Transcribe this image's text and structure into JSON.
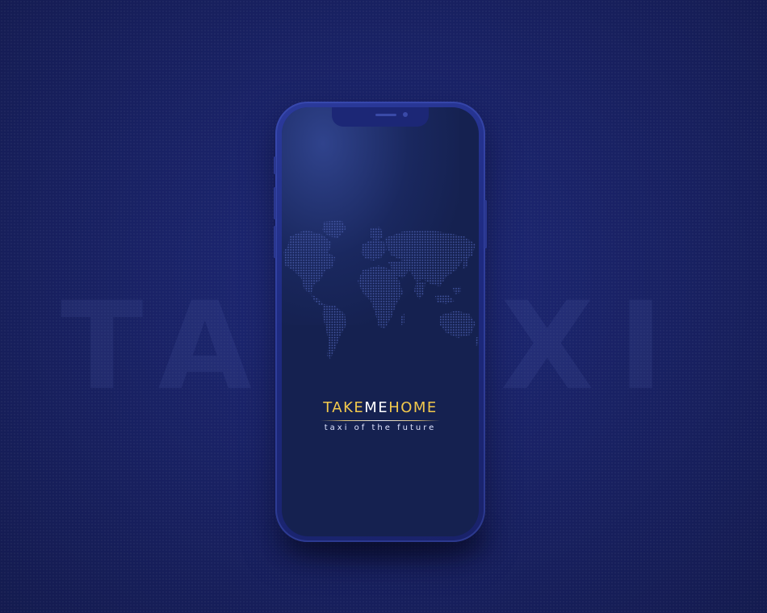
{
  "background": {
    "word_left": "TA",
    "word_right": "XI",
    "color": "#1a2368"
  },
  "app": {
    "logo_part1": "TAKE",
    "logo_part2": "ME",
    "logo_part3": "HOME",
    "tagline": "taxi of the future",
    "accent_color": "#f2c94c",
    "screen_color": "#152150"
  },
  "icons": {
    "map": "world-map-icon",
    "camera": "camera-icon",
    "speaker": "speaker-icon"
  }
}
